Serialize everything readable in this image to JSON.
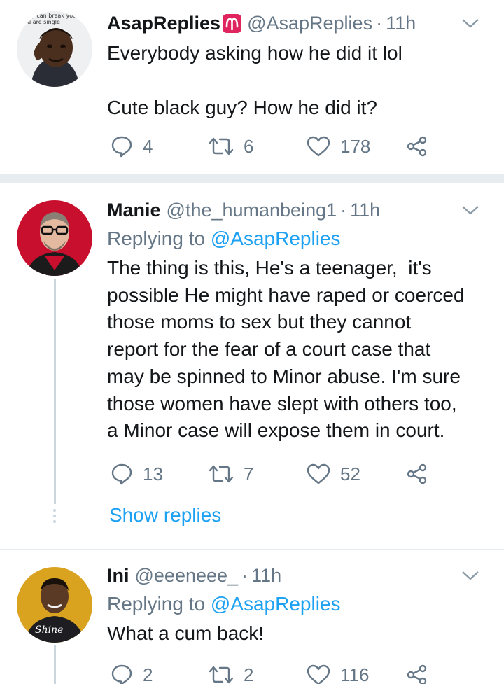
{
  "tweets": [
    {
      "name": "AsapReplies",
      "handle": "@AsapReplies",
      "dot": "·",
      "time": "11h",
      "avatar_text": [
        "..y can break you.",
        "..u are single"
      ],
      "text": "Everybody asking how he did it lol\n\nCute black guy? How he did it?",
      "counts": {
        "replies": "4",
        "retweets": "6",
        "likes": "178"
      }
    },
    {
      "name": "Manie",
      "handle": "@the_humanbeing1",
      "dot": "·",
      "time": "11h",
      "replying_prefix": "Replying to",
      "replying_to": "@AsapReplies",
      "text": "The thing is this, He's a teenager,  it's\npossible He might have raped or coerced\nthose moms to sex but they cannot\nreport for the fear of a court case that\nmay be spinned to Minor abuse. I'm sure\nthose women have slept with others too,\na Minor case will expose them in court.",
      "counts": {
        "replies": "13",
        "retweets": "7",
        "likes": "52"
      },
      "show_replies": "Show replies"
    },
    {
      "name": "Ini",
      "handle": "@eeeneee_",
      "dot": "·",
      "time": "11h",
      "replying_prefix": "Replying to",
      "replying_to": "@AsapReplies",
      "avatar_shirt_text": "Shine",
      "text": "What a cum back!",
      "counts": {
        "replies": "2",
        "retweets": "2",
        "likes": "116"
      }
    }
  ],
  "colors": {
    "text": "#14171a",
    "secondary": "#657786",
    "accent": "#1da1f2",
    "divider": "#e6ecf0",
    "thread": "#ccd6dd",
    "aries_badge": "#e0245e"
  },
  "icons": [
    "reply-icon",
    "retweet-icon",
    "like-icon",
    "share-icon",
    "chevron-down-icon",
    "aries-badge-icon"
  ]
}
